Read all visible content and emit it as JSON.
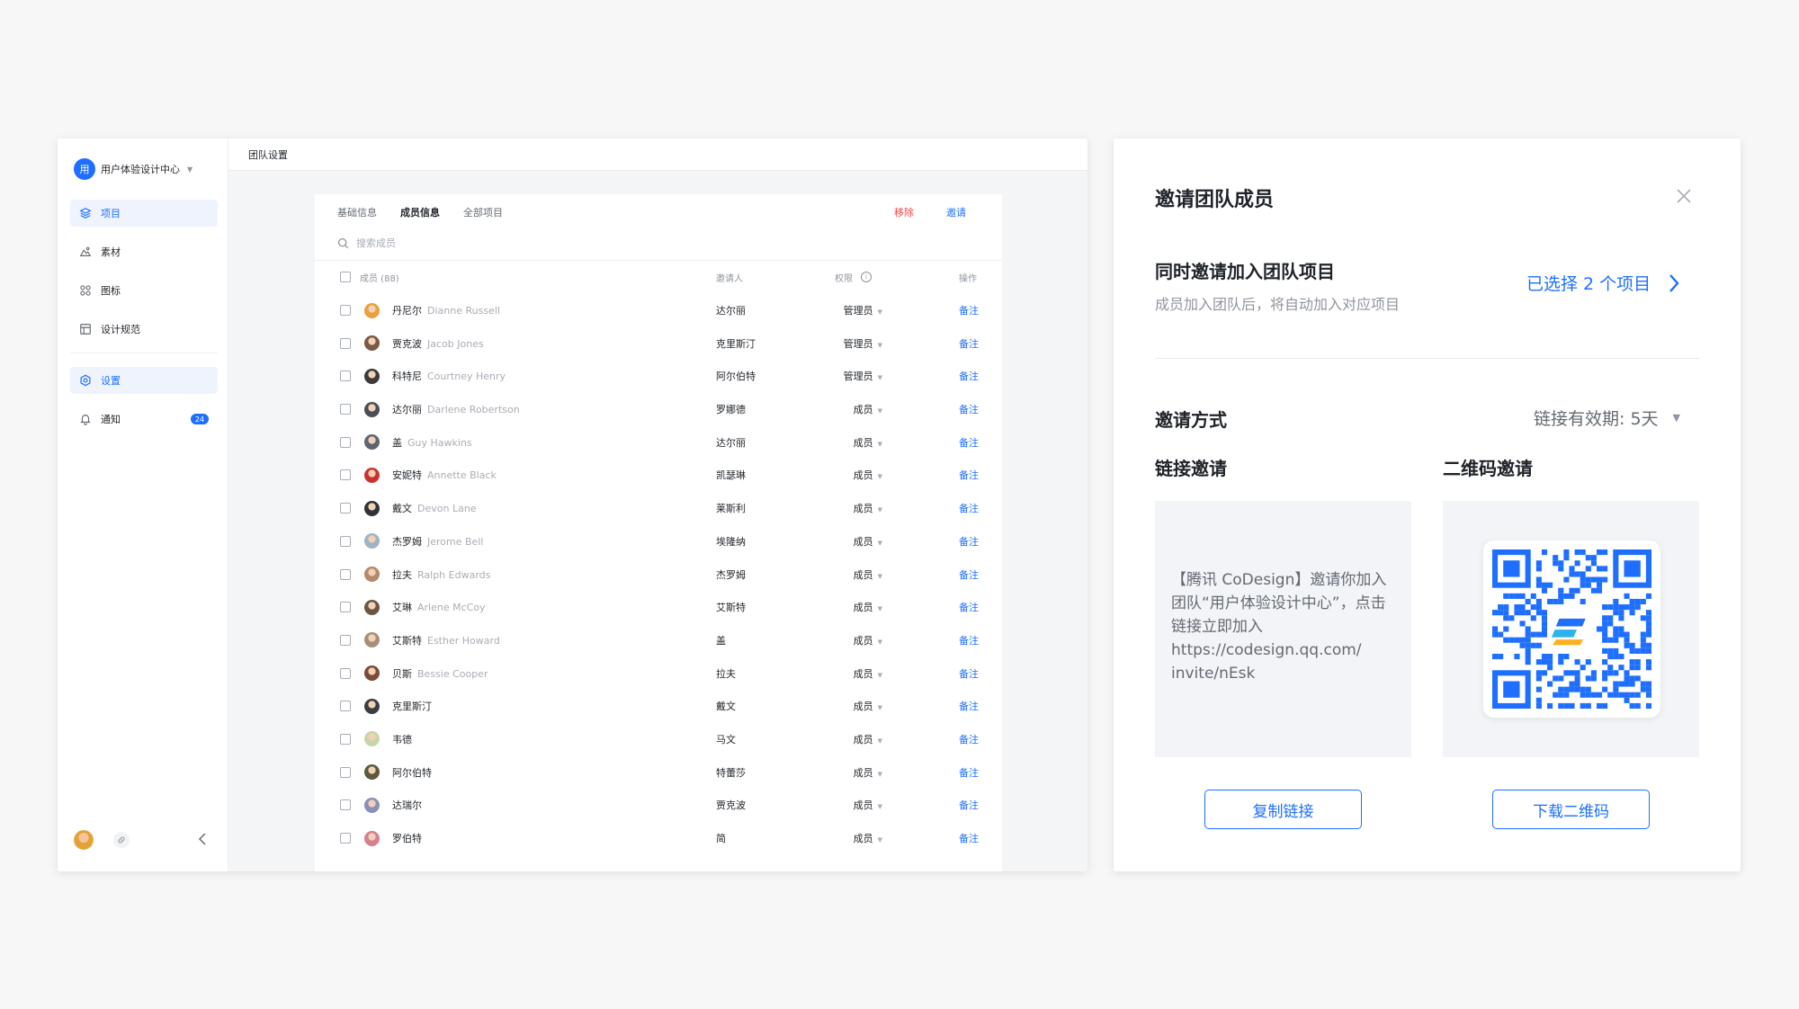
{
  "sidebar": {
    "team_avatar": "用",
    "team_name": "用户体验设计中心",
    "items": [
      {
        "label": "项目",
        "icon": "layers-icon",
        "active": true
      },
      {
        "label": "素材",
        "icon": "image-icon",
        "active": false
      },
      {
        "label": "图标",
        "icon": "grid-icon",
        "active": false
      },
      {
        "label": "设计规范",
        "icon": "layout-icon",
        "active": false
      },
      {
        "label": "设置",
        "icon": "settings-icon",
        "active": true
      },
      {
        "label": "通知",
        "icon": "bell-icon",
        "active": false,
        "badge": "24"
      }
    ]
  },
  "topbar": {
    "title": "团队设置"
  },
  "members_panel": {
    "tabs": [
      "基础信息",
      "成员信息",
      "全部项目"
    ],
    "active_tab": 1,
    "remove_label": "移除",
    "invite_label": "邀请",
    "search_placeholder": "搜索成员",
    "headers": {
      "members": "成员 (88)",
      "inviter": "邀请人",
      "permission": "权限",
      "action": "操作"
    },
    "rows": [
      {
        "name": "丹尼尔",
        "en": "Dianne Russell",
        "inviter": "达尔丽",
        "role": "管理员",
        "action": "备注",
        "avatar": "#e8a13c"
      },
      {
        "name": "贾克波",
        "en": "Jacob Jones",
        "inviter": "克里斯汀",
        "role": "管理员",
        "action": "备注",
        "avatar": "#7a5a44"
      },
      {
        "name": "科特尼",
        "en": "Courtney Henry",
        "inviter": "阿尔伯特",
        "role": "管理员",
        "action": "备注",
        "avatar": "#3d3a39"
      },
      {
        "name": "达尔丽",
        "en": "Darlene Robertson",
        "inviter": "罗娜德",
        "role": "成员",
        "action": "备注",
        "avatar": "#4a4e57"
      },
      {
        "name": "盖",
        "en": "Guy Hawkins",
        "inviter": "达尔丽",
        "role": "成员",
        "action": "备注",
        "avatar": "#5d6571"
      },
      {
        "name": "安妮特",
        "en": "Annette Black",
        "inviter": "凯瑟琳",
        "role": "成员",
        "action": "备注",
        "avatar": "#c9332e"
      },
      {
        "name": "戴文",
        "en": "Devon Lane",
        "inviter": "莱斯利",
        "role": "成员",
        "action": "备注",
        "avatar": "#2f3237"
      },
      {
        "name": "杰罗姆",
        "en": "Jerome Bell",
        "inviter": "埃隆纳",
        "role": "成员",
        "action": "备注",
        "avatar": "#9fb2c8"
      },
      {
        "name": "拉夫",
        "en": "Ralph Edwards",
        "inviter": "杰罗姆",
        "role": "成员",
        "action": "备注",
        "avatar": "#b38a6b"
      },
      {
        "name": "艾琳",
        "en": "Arlene McCoy",
        "inviter": "艾斯特",
        "role": "成员",
        "action": "备注",
        "avatar": "#6b5545"
      },
      {
        "name": "艾斯特",
        "en": "Esther Howard",
        "inviter": "盖",
        "role": "成员",
        "action": "备注",
        "avatar": "#a98f7a"
      },
      {
        "name": "贝斯",
        "en": "Bessie Cooper",
        "inviter": "拉夫",
        "role": "成员",
        "action": "备注",
        "avatar": "#7d4a3a"
      },
      {
        "name": "克里斯汀",
        "en": "",
        "inviter": "戴文",
        "role": "成员",
        "action": "备注",
        "avatar": "#3a3d44"
      },
      {
        "name": "韦德",
        "en": "",
        "inviter": "马文",
        "role": "成员",
        "action": "备注",
        "avatar": "#c8d5a8"
      },
      {
        "name": "阿尔伯特",
        "en": "",
        "inviter": "特蕾莎",
        "role": "成员",
        "action": "备注",
        "avatar": "#5c5a3c"
      },
      {
        "name": "达瑞尔",
        "en": "",
        "inviter": "贾克波",
        "role": "成员",
        "action": "备注",
        "avatar": "#8a8fb8"
      },
      {
        "name": "罗伯特",
        "en": "",
        "inviter": "简",
        "role": "成员",
        "action": "备注",
        "avatar": "#d67f8f"
      }
    ]
  },
  "invite_dialog": {
    "title": "邀请团队成员",
    "sync_title": "同时邀请加入团队项目",
    "sync_subtitle": "成员加入团队后，将自动加入对应项目",
    "selected_label": "已选择 2 个项目",
    "method_title": "邀请方式",
    "expire_label": "链接有效期: 5天",
    "link_title": "链接邀请",
    "qr_title": "二维码邀请",
    "link_text_1": "【腾讯 CoDesign】邀请你加入团队“用户体验设计中心”，点击链接立即加入",
    "link_text_2": "https://codesign.qq.com/",
    "link_text_3": "invite/nEsk",
    "copy_button": "复制链接",
    "download_button": "下载二维码"
  },
  "colors": {
    "accent": "#1e6fff",
    "danger": "#f54a45",
    "muted": "#8f959e"
  }
}
